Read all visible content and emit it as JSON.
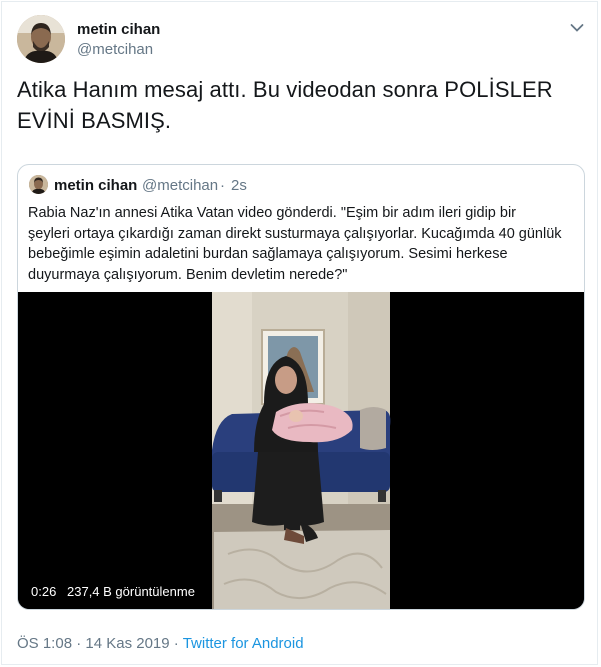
{
  "tweet": {
    "author_name": "metin cihan",
    "author_handle": "@metcihan",
    "text_line1": "Atika Hanım mesaj attı. Bu videodan sonra POLİSLER",
    "text_line2": "EVİNİ BASMIŞ.",
    "timestamp": "ÖS 1:08 · 14 Kas 2019",
    "separator": "·",
    "source": "Twitter for Android"
  },
  "quoted_tweet": {
    "author_name": "metin cihan",
    "author_handle": "@metcihan",
    "separator": "·",
    "time_ago": "2s",
    "text_lines": [
      "Rabia Naz'ın annesi Atika Vatan video gönderdi. \"Eşim bir adım ileri gidip bir",
      "şeyleri ortaya çıkardığı zaman direkt susturmaya çalışıyorlar. Kucağımda 40 günlük",
      "bebeğimle eşimin adaletini burdan sağlamaya çalışıyorum. Sesimi herkese",
      "duyurmaya çalışıyorum. Benim devletim nerede?\""
    ],
    "video": {
      "duration": "0:26",
      "views": "237,4 B görüntülenme"
    }
  },
  "icons": {
    "avatar": "avatar-photo",
    "caret": "chevron-down-icon"
  }
}
